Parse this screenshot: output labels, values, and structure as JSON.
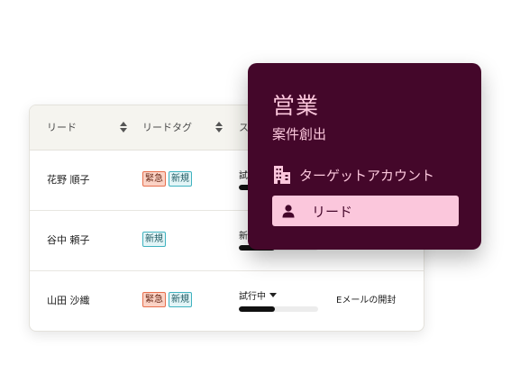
{
  "table": {
    "headers": [
      {
        "label": "リード"
      },
      {
        "label": "リードタグ"
      },
      {
        "label": "ス"
      }
    ],
    "rows": [
      {
        "name": "花野 順子",
        "tags": [
          "緊急",
          "新規"
        ],
        "status": "試",
        "progress": 0.45,
        "activity": ""
      },
      {
        "name": "谷中 頼子",
        "tags": [
          "新規"
        ],
        "status": "新",
        "progress": 0.45,
        "activity": ""
      },
      {
        "name": "山田 沙織",
        "tags": [
          "緊急",
          "新規"
        ],
        "status": "試行中",
        "progress": 0.45,
        "activity": "Eメールの開封"
      }
    ]
  },
  "menu": {
    "title": "営業",
    "subtitle": "案件創出",
    "items": [
      {
        "label": "ターゲットアカウント",
        "icon": "building-icon",
        "active": false
      },
      {
        "label": "リード",
        "icon": "person-icon",
        "active": true
      }
    ]
  },
  "colors": {
    "menu_bg": "#44072a",
    "menu_accent": "#fbc7dc",
    "tag_urgent": "#fbd3c6",
    "tag_new": "#e3f5f7"
  }
}
